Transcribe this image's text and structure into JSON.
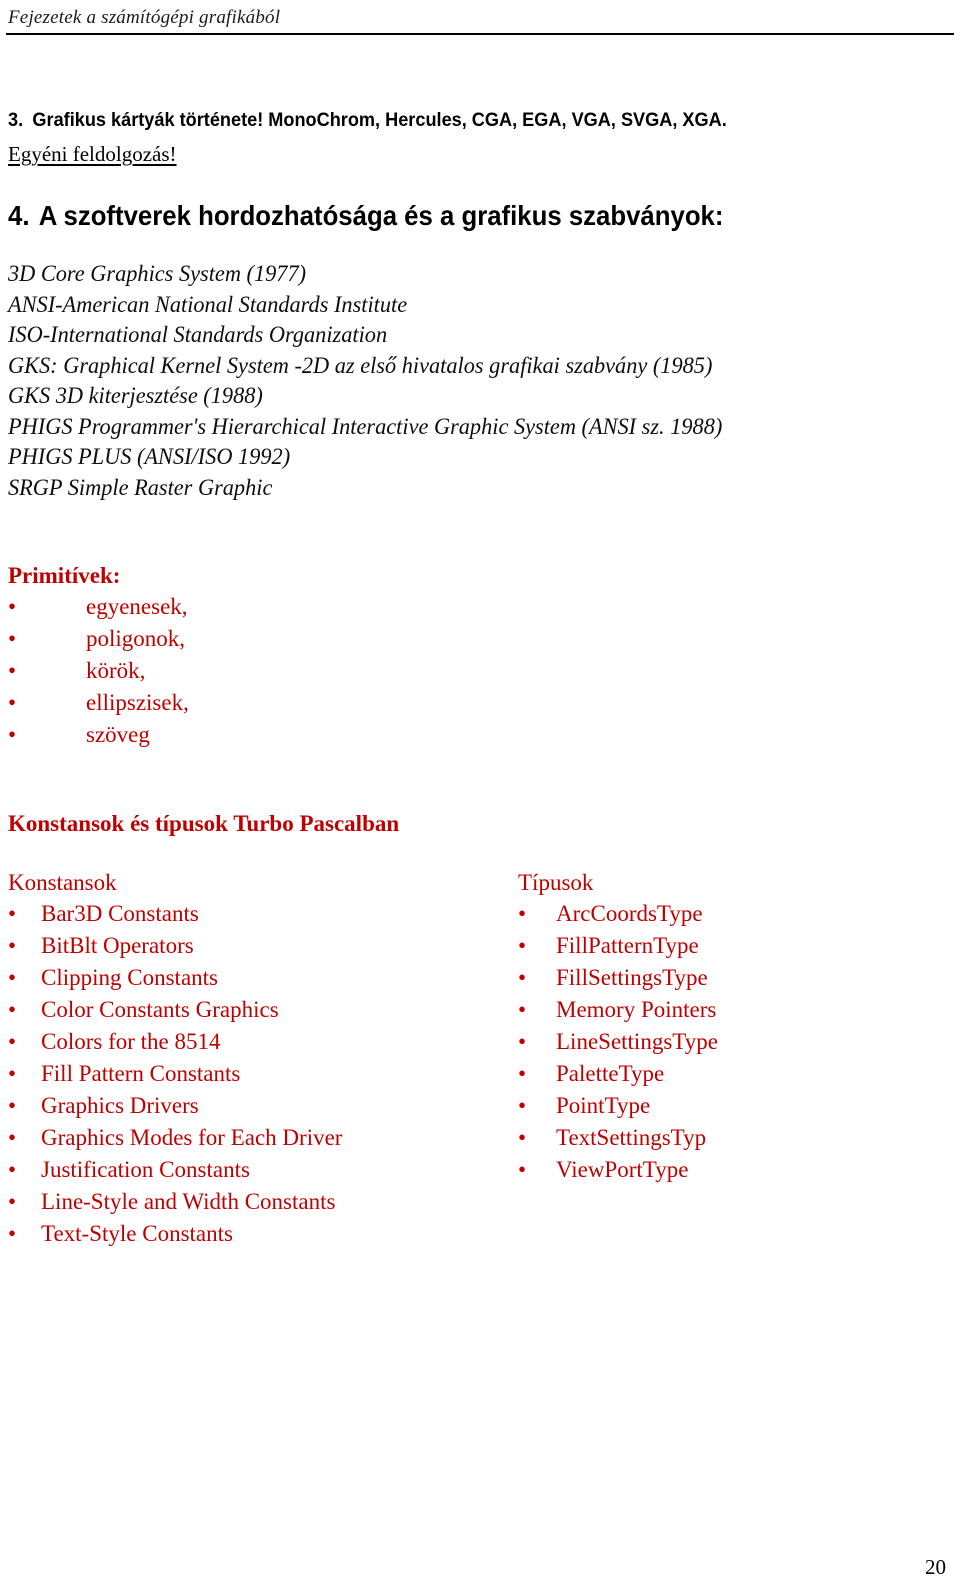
{
  "document": {
    "running_header": "Fejezetek a számítógépi grafikából",
    "page_number": "20"
  },
  "sections": {
    "item3": {
      "number": "3.",
      "title": "Grafikus kártyák története! MonoChrom, Hercules, CGA, EGA, VGA, SVGA, XGA.",
      "subnote": "Egyéni feldolgozás!"
    },
    "item4": {
      "number": "4.",
      "title": "A szoftverek hordozhatósága és a grafikus szabványok:"
    }
  },
  "standards": [
    "3D Core Graphics System (1977)",
    "ANSI-American National Standards Institute",
    "ISO-International Standards Organization",
    "GKS: Graphical Kernel System -2D az első hivatalos grafikai szabvány (1985)",
    "GKS 3D kiterjesztése (1988)",
    "PHIGS Programmer's Hierarchical Interactive Graphic System (ANSI sz. 1988)",
    "PHIGS PLUS (ANSI/ISO 1992)",
    "SRGP Simple Raster Graphic"
  ],
  "primitives": {
    "heading": "Primitívek:",
    "bullet_glyph": "•",
    "items": [
      "egyenesek,",
      "poligonok,",
      "körök,",
      "ellipszisek,",
      "szöveg"
    ]
  },
  "turbo_pascal": {
    "heading": "Konstansok és típusok Turbo Pascalban",
    "columns": [
      {
        "title": "Konstansok",
        "items": [
          "Bar3D Constants",
          "BitBlt Operators",
          "Clipping Constants",
          "Color Constants Graphics",
          "Colors for the 8514",
          "Fill Pattern Constants",
          "Graphics Drivers",
          "Graphics Modes for Each Driver",
          "Justification Constants",
          "Line-Style and Width Constants",
          "Text-Style Constants"
        ]
      },
      {
        "title": "Típusok",
        "items": [
          "ArcCoordsType",
          "FillPatternType",
          "FillSettingsType",
          "Memory Pointers",
          "LineSettingsType",
          "PaletteType",
          "PointType",
          "TextSettingsTyp",
          "ViewPortType"
        ]
      }
    ]
  },
  "colors": {
    "accent_red": "#C00000",
    "text_black": "#000000"
  }
}
